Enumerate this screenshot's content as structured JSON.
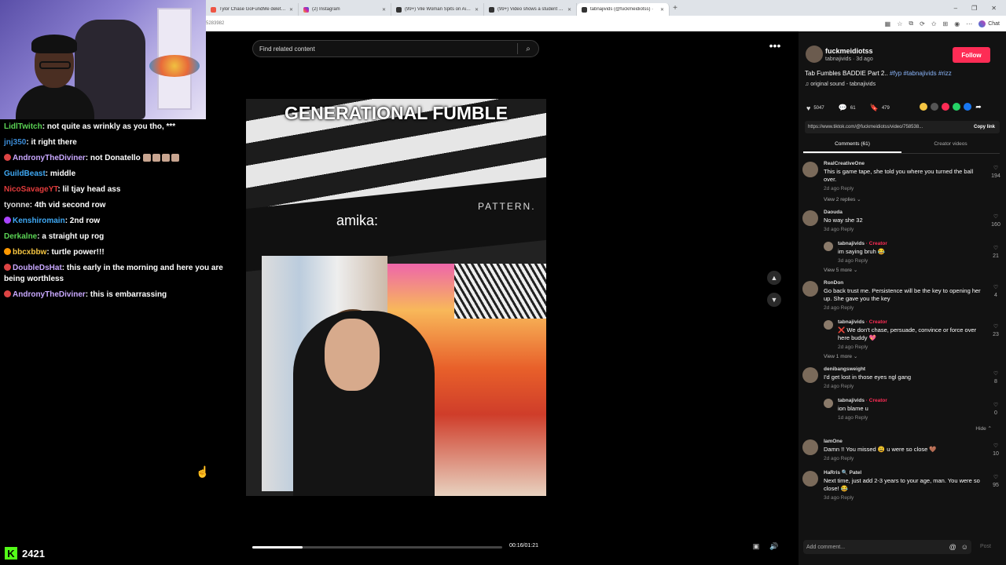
{
  "browser": {
    "tabs": [
      {
        "title": "Tylor Chase GoFundMe deleted af",
        "icon": "red"
      },
      {
        "title": "(2) Instagram",
        "icon": "ig"
      },
      {
        "title": "(99+) Vile Woman Spits on Airline",
        "icon": "x"
      },
      {
        "title": "(99+) Video shows a student being",
        "icon": "x"
      },
      {
        "title": "tabnajivids (@fuckmeidiotss) · ",
        "icon": "tiktok",
        "active": true
      }
    ],
    "url_fragment": "5283982",
    "chat_label": "Chat"
  },
  "chat": {
    "messages": [
      {
        "user": "LidlTwitch",
        "color": "#5bd455",
        "text": "not quite as wrinkly as you tho, ***",
        "badge": ""
      },
      {
        "user": "jnj350",
        "color": "#3b8bd6",
        "text": "it right there",
        "badge": ""
      },
      {
        "user": "AndronyTheDiviner",
        "color": "#c9a8ff",
        "text": "not Donatello",
        "badge": "#d44",
        "emotes": 4
      },
      {
        "user": "GuildBeast",
        "color": "#3fa9f5",
        "text": "middle",
        "badge": ""
      },
      {
        "user": "NicoSavageYT",
        "color": "#e23c3c",
        "text": "lil tjay head ass",
        "badge": ""
      },
      {
        "user": "tyonne",
        "color": "#ddd",
        "text": "4th vid second row",
        "badge": ""
      },
      {
        "user": "Kenshiromain",
        "color": "#3fa9f5",
        "text": "2nd row",
        "badge": "#a4f"
      },
      {
        "user": "Derkalne",
        "color": "#5bd455",
        "text": "a straight up rog",
        "badge": ""
      },
      {
        "user": "bbcxbbw",
        "color": "#f5c542",
        "text": "turtle power!!!",
        "badge": "#f90"
      },
      {
        "user": "DoubleDsHat",
        "color": "#c9a8ff",
        "text": "this early in the morning and here you are being worthless",
        "badge": "#d44"
      },
      {
        "user": "AndronyTheDiviner",
        "color": "#c9a8ff",
        "text": "this is embarrassing",
        "badge": "#d44"
      }
    ],
    "viewer_count": "2421",
    "logo": "K"
  },
  "player": {
    "search_placeholder": "Find related content",
    "caption": "GENERATIONAL FUMBLE",
    "store_sign": "amika:",
    "store_sign2": "PATTERN.",
    "time": "00:16/01:21",
    "progress": 0.2,
    "more_glyph": "•••"
  },
  "post": {
    "username": "fuckmeidiotss",
    "handle": "tabnajivids · 3d ago",
    "follow_label": "Follow",
    "description": "Tab Fumbles BADDIE Part 2.. ",
    "hashtags": "#fyp #tabnajivids #rizz",
    "sound": "♫  original sound - tabnajivids",
    "likes": "5047",
    "comments_count": "61",
    "saves": "479",
    "link": "https://www.tiktok.com/@fuckmeidiotss/video/758538...",
    "copy_label": "Copy link",
    "tab_comments": "Comments (61)",
    "tab_creator": "Creator videos",
    "add_comment": "Add comment...",
    "post_label": "Post"
  },
  "comments": [
    {
      "name": "RealCreativeOne",
      "text": "This is game tape, she told you where you turned the ball over.",
      "meta": "2d ago    Reply",
      "likes": "194",
      "more": "View 2 replies ⌄"
    },
    {
      "name": "Daouda",
      "text": "No way she 32",
      "meta": "3d ago    Reply",
      "likes": "160",
      "reply": {
        "name": "tabnajivids",
        "tag": " · Creator",
        "text": "im saying bruh 😂",
        "meta": "3d ago    Reply",
        "likes": "21"
      },
      "more": "View 5 more ⌄"
    },
    {
      "name": "RonDon",
      "text": "Go back trust me. Persistence will be the key to opening her up. She gave you the key",
      "meta": "2d ago    Reply",
      "likes": "4",
      "reply": {
        "name": "tabnajivids",
        "tag": " · Creator",
        "text": "❌ We don't chase, persuade, convince or force over here buddy 💖",
        "meta": "2d ago    Reply",
        "likes": "23"
      },
      "more": "View 1 more ⌄"
    },
    {
      "name": "denibangsweight",
      "text": "I'd get lost in those eyes ngl gang",
      "meta": "2d ago    Reply",
      "likes": "8",
      "reply": {
        "name": "tabnajivids",
        "tag": " · Creator",
        "text": "ion blame u",
        "meta": "1d ago    Reply",
        "likes": "0"
      },
      "hide": "Hide ⌃"
    },
    {
      "name": "IamOne",
      "text": "Damn !! You missed 😩 u were so close 🤎",
      "meta": "2d ago    Reply",
      "likes": "10"
    },
    {
      "name": "HaRris 🔍 Patel",
      "text": "Next time, just add 2-3 years to your age, man. You were so close! 😂",
      "meta": "3d ago    Reply",
      "likes": "95"
    }
  ]
}
